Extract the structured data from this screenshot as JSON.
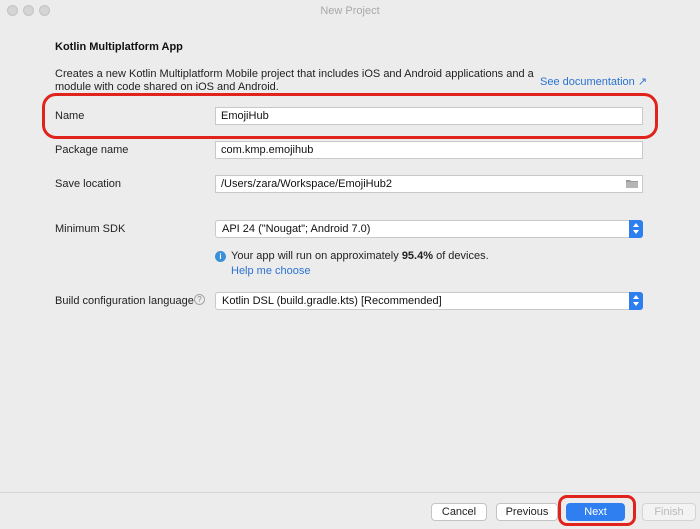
{
  "window": {
    "title": "New Project"
  },
  "header": {
    "heading": "Kotlin Multiplatform App",
    "description": "Creates a new Kotlin Multiplatform Mobile project that includes iOS and Android applications and a module with code shared on iOS and Android.",
    "doc_link": "See documentation ↗"
  },
  "form": {
    "name": {
      "label": "Name",
      "value": "EmojiHub"
    },
    "package": {
      "label": "Package name",
      "value": "com.kmp.emojihub"
    },
    "save_location": {
      "label": "Save location",
      "value": "/Users/zara/Workspace/EmojiHub2"
    },
    "min_sdk": {
      "label": "Minimum SDK",
      "value": "API 24 (\"Nougat\"; Android 7.0)",
      "info_prefix": "Your app will run on approximately",
      "info_percent": "95.4%",
      "info_suffix": "of devices.",
      "help_link": "Help me choose"
    },
    "build_language": {
      "label": "Build configuration language",
      "value": "Kotlin DSL (build.gradle.kts) [Recommended]"
    }
  },
  "footer": {
    "cancel": "Cancel",
    "previous": "Previous",
    "next": "Next",
    "finish": "Finish"
  },
  "colors": {
    "accent": "#2f7ff1",
    "highlight": "#e0231b",
    "link": "#2c73d2"
  },
  "icons": {
    "info": "i",
    "help": "?"
  }
}
